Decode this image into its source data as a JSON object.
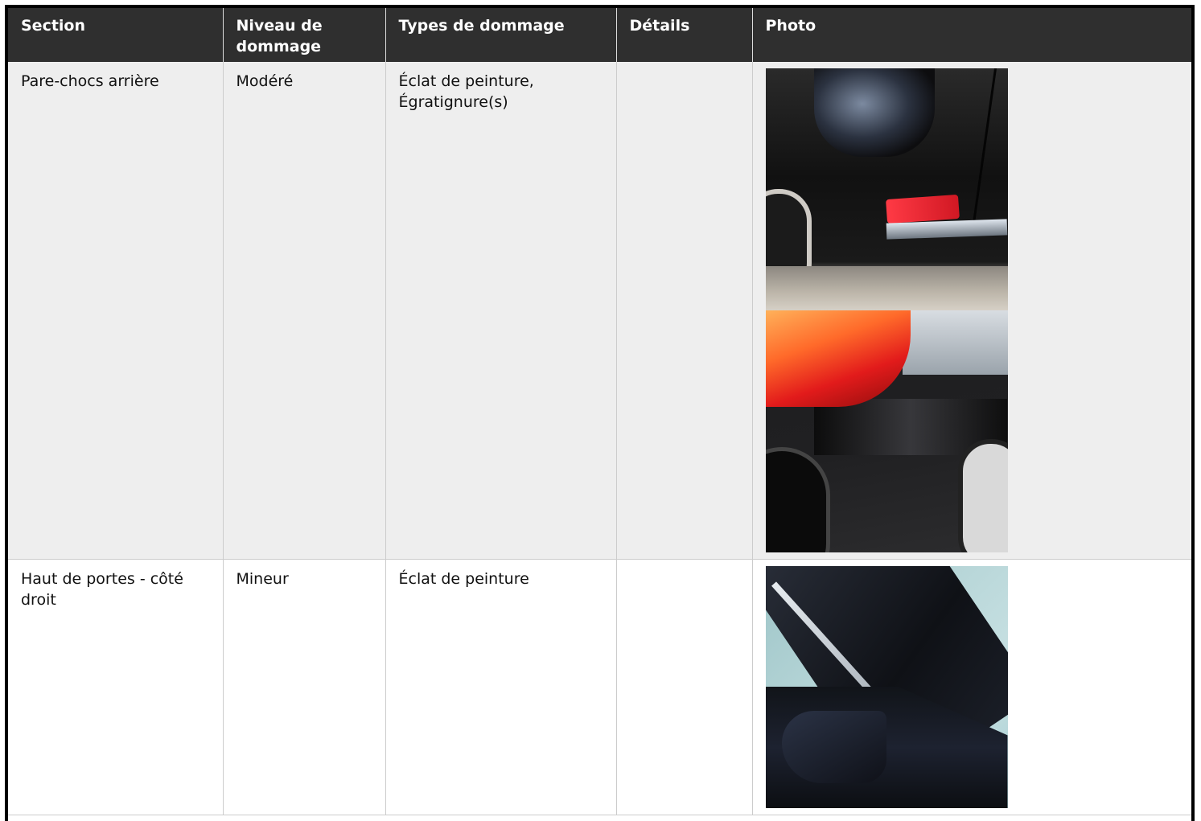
{
  "table": {
    "headers": {
      "section": "Section",
      "level": "Niveau de dommage",
      "types": "Types de dommage",
      "details": "Détails",
      "photo": "Photo"
    },
    "rows": [
      {
        "section": "Pare-chocs arrière",
        "level": "Modéré",
        "types": "Éclat de peinture, Égratignure(s)",
        "details": "",
        "photos": [
          "rear-bumper-photo",
          "tail-light-panel-photo"
        ]
      },
      {
        "section": "Haut de portes - côté droit",
        "level": "Mineur",
        "types": "Éclat de peinture",
        "details": "",
        "photos": [
          "door-top-photo"
        ]
      }
    ]
  },
  "colors": {
    "header_bg": "#2f2f2f",
    "header_text": "#ffffff",
    "row_odd_bg": "#eeeeee",
    "row_even_bg": "#ffffff"
  }
}
